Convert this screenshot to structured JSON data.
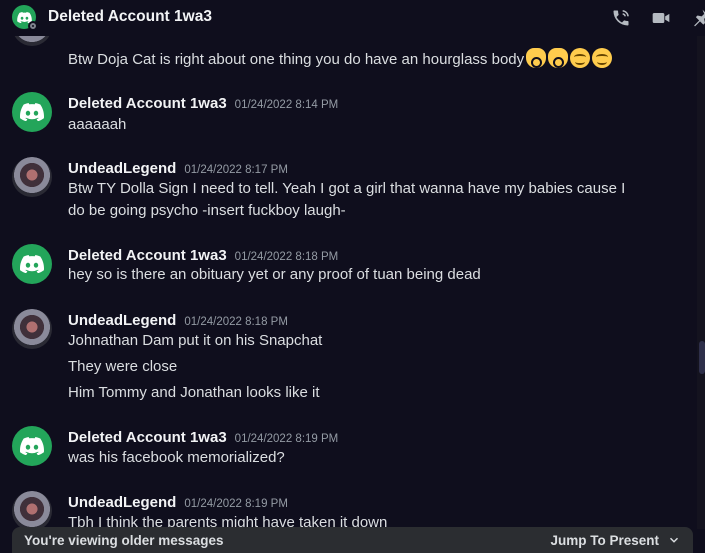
{
  "header": {
    "title": "Deleted Account 1wa3",
    "icons": [
      "phone-call-icon",
      "video-camera-icon",
      "pin-icon"
    ]
  },
  "messages": [
    {
      "author": "",
      "timestamp": "",
      "avatar": "user-avatar",
      "lines": [
        "Btw Doja Cat is right about one thing you do have an hourglass body"
      ],
      "emojis": [
        "ok-hand",
        "ok-hand",
        "relieved-face",
        "relieved-face"
      ]
    },
    {
      "author": "Deleted Account 1wa3",
      "timestamp": "01/24/2022 8:14 PM",
      "avatar": "discord-avatar",
      "lines": [
        "aaaaaah"
      ]
    },
    {
      "author": "UndeadLegend",
      "timestamp": "01/24/2022 8:17 PM",
      "avatar": "user-avatar",
      "lines": [
        "Btw TY Dolla Sign I need to tell. Yeah I got a girl that wanna have my babies cause I",
        "do be going psycho  -insert fuckboy laugh-"
      ]
    },
    {
      "author": "Deleted Account 1wa3",
      "timestamp": "01/24/2022 8:18 PM",
      "avatar": "discord-avatar",
      "lines": [
        "hey so is there an obituary yet or any proof of tuan being dead"
      ]
    },
    {
      "author": "UndeadLegend",
      "timestamp": "01/24/2022 8:18 PM",
      "avatar": "user-avatar",
      "lines": [
        "Johnathan Dam put it on his Snapchat",
        "They were close",
        "Him Tommy and Jonathan looks like it"
      ]
    },
    {
      "author": "Deleted Account 1wa3",
      "timestamp": "01/24/2022 8:19 PM",
      "avatar": "discord-avatar",
      "lines": [
        "was his facebook memorialized?"
      ]
    },
    {
      "author": "UndeadLegend",
      "timestamp": "01/24/2022 8:19 PM",
      "avatar": "user-avatar",
      "lines": [
        "Tbh I think the parents might have taken it down"
      ]
    }
  ],
  "bottom_bar": {
    "status_text": "You're viewing older messages",
    "jump_label": "Jump To Present"
  },
  "colors": {
    "background": "#0f0e1d",
    "discord_green": "#23a55a",
    "bar": "#2b2d31"
  }
}
